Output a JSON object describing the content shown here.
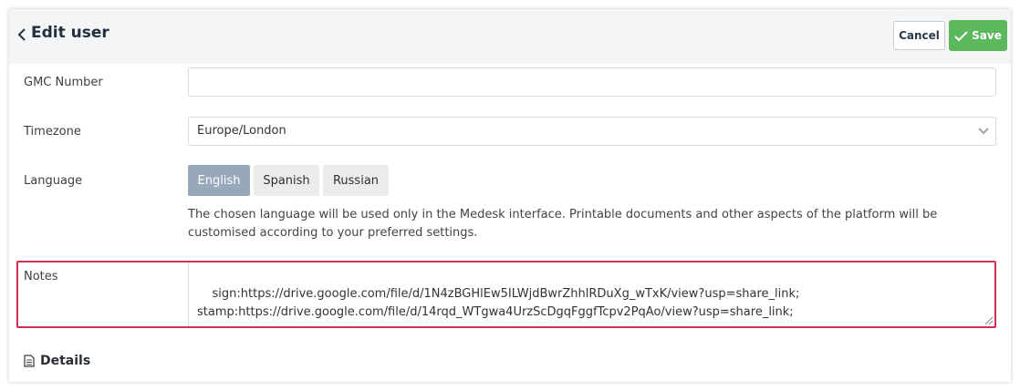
{
  "header": {
    "title": "Edit user",
    "cancel_label": "Cancel",
    "save_label": "Save"
  },
  "form": {
    "gmc": {
      "label": "GMC Number",
      "value": ""
    },
    "timezone": {
      "label": "Timezone",
      "value": "Europe/London"
    },
    "language": {
      "label": "Language",
      "options": [
        "English",
        "Spanish",
        "Russian"
      ],
      "selected": "English",
      "help": "The chosen language will be used only in the Medesk interface. Printable documents and other aspects of the platform will be customised according to your preferred settings."
    },
    "notes": {
      "label": "Notes",
      "value": "sign:https://drive.google.com/file/d/1N4zBGHlEw5ILWjdBwrZhhlRDuXg_wTxK/view?usp=share_link;\nstamp:https://drive.google.com/file/d/14rqd_WTgwa4UrzScDgqFggfTcpv2PqAo/view?usp=share_link;"
    }
  },
  "details": {
    "label": "Details"
  },
  "icons": {
    "back": "chevron-left-icon",
    "save": "check-icon",
    "select": "chevron-down-icon",
    "details": "document-icon"
  },
  "colors": {
    "save": "#5cb85c",
    "highlight": "#d32f55",
    "lang_active": "#96a8b9"
  }
}
